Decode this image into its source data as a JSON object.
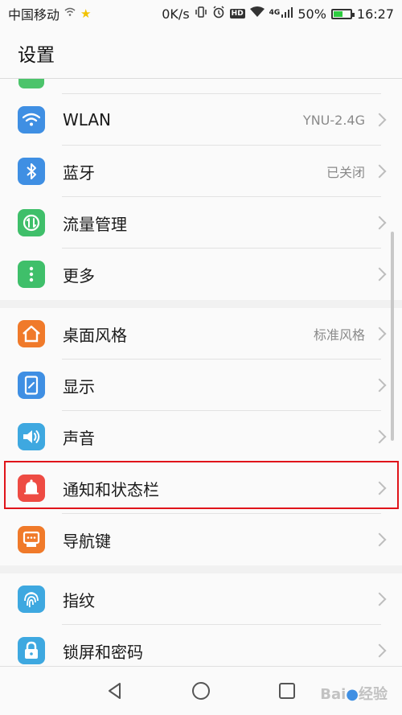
{
  "status_bar": {
    "carrier": "中国移动",
    "speed": "0K/s",
    "hd": "HD",
    "network": "4G",
    "battery": "50%",
    "battery_level": 0.5,
    "time": "16:27"
  },
  "header": {
    "title": "设置"
  },
  "groups": [
    {
      "items": [
        {
          "label": "WLAN",
          "value": "YNU-2.4G",
          "icon": "wifi-icon",
          "color": "#3f8fe3"
        },
        {
          "label": "蓝牙",
          "value": "已关闭",
          "icon": "bluetooth-icon",
          "color": "#3f8fe3"
        },
        {
          "label": "流量管理",
          "value": "",
          "icon": "data-usage-icon",
          "color": "#3fbf6a"
        },
        {
          "label": "更多",
          "value": "",
          "icon": "more-icon",
          "color": "#3fbf6a"
        }
      ]
    },
    {
      "items": [
        {
          "label": "桌面风格",
          "value": "标准风格",
          "icon": "home-icon",
          "color": "#f07a2a"
        },
        {
          "label": "显示",
          "value": "",
          "icon": "display-icon",
          "color": "#3f8fe3"
        },
        {
          "label": "声音",
          "value": "",
          "icon": "sound-icon",
          "color": "#3ea8e0"
        },
        {
          "label": "通知和状态栏",
          "value": "",
          "icon": "bell-icon",
          "color": "#ee4b43"
        },
        {
          "label": "导航键",
          "value": "",
          "icon": "navigation-key-icon",
          "color": "#f07a2a"
        }
      ]
    },
    {
      "items": [
        {
          "label": "指纹",
          "value": "",
          "icon": "fingerprint-icon",
          "color": "#3ea8e0"
        },
        {
          "label": "锁屏和密码",
          "value": "",
          "icon": "lock-icon",
          "color": "#3ea8e0"
        }
      ]
    }
  ]
}
